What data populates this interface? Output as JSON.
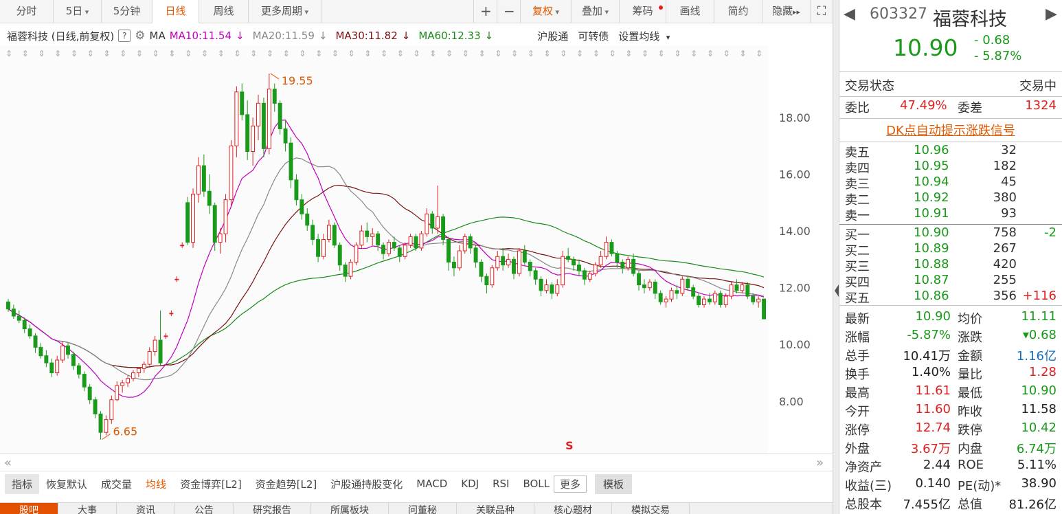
{
  "toolbar": {
    "tabs": [
      "分时",
      "5日",
      "5分钟",
      "日线",
      "周线",
      "更多周期"
    ],
    "right": [
      "+",
      "−",
      "复权",
      "叠加",
      "筹码",
      "画线",
      "简约",
      "隐藏"
    ],
    "hide_arrow": "▸▸",
    "fullscreen_icon": "⛶"
  },
  "info": {
    "name_mode": "福蓉科技 (日线,前复权)",
    "help": "?",
    "ma_label": "MA",
    "ma10": "MA10:11.54",
    "ma20": "MA20:11.59",
    "ma30": "MA30:11.82",
    "ma60": "MA60:12.33",
    "down_arrow": "↓",
    "links": [
      "沪股通",
      "可转债",
      "设置均线"
    ]
  },
  "colors": {
    "up": "#e02020",
    "down": "#1a9a1a",
    "ma10": "#c000c0",
    "ma20": "#888888",
    "ma30": "#7a1010",
    "ma60": "#1a8a1a",
    "accent": "#e05a00"
  },
  "chart_data": {
    "type": "candlestick",
    "ylim": [
      6.3,
      20.4
    ],
    "yticks": [
      "18.00",
      "16.00",
      "14.00",
      "12.00",
      "10.00",
      "8.00"
    ],
    "annotations": {
      "high": "19.55",
      "low": "6.65"
    },
    "marker": "S",
    "ohlc": [
      [
        11.5,
        11.6,
        11.15,
        11.25
      ],
      [
        11.25,
        11.4,
        10.9,
        11.0
      ],
      [
        11.0,
        11.2,
        10.75,
        10.85
      ],
      [
        10.85,
        10.95,
        10.4,
        10.55
      ],
      [
        10.55,
        10.7,
        10.2,
        10.3
      ],
      [
        10.3,
        10.4,
        9.7,
        9.9
      ],
      [
        9.9,
        10.05,
        9.5,
        9.6
      ],
      [
        9.6,
        9.8,
        9.2,
        9.35
      ],
      [
        9.35,
        9.5,
        8.85,
        9.0
      ],
      [
        9.0,
        9.6,
        8.9,
        9.45
      ],
      [
        9.45,
        10.1,
        9.35,
        9.95
      ],
      [
        9.95,
        10.05,
        9.5,
        9.65
      ],
      [
        9.65,
        9.75,
        9.1,
        9.25
      ],
      [
        9.25,
        9.35,
        8.8,
        8.95
      ],
      [
        8.95,
        9.05,
        8.35,
        8.5
      ],
      [
        8.5,
        8.6,
        7.9,
        8.05
      ],
      [
        8.05,
        8.15,
        7.4,
        7.55
      ],
      [
        7.55,
        7.65,
        6.65,
        6.9
      ],
      [
        6.9,
        7.5,
        6.8,
        7.35
      ],
      [
        7.35,
        8.2,
        7.2,
        8.05
      ],
      [
        8.05,
        8.7,
        8.0,
        8.55
      ],
      [
        8.55,
        8.75,
        8.3,
        8.65
      ],
      [
        8.65,
        8.9,
        8.5,
        8.8
      ],
      [
        8.8,
        9.1,
        8.7,
        9.0
      ],
      [
        9.0,
        9.2,
        8.85,
        9.15
      ],
      [
        9.15,
        9.4,
        9.0,
        9.3
      ],
      [
        9.3,
        9.9,
        9.25,
        9.75
      ],
      [
        9.75,
        10.3,
        9.6,
        10.15
      ],
      [
        10.15,
        11.2,
        9.25,
        9.35
      ],
      [
        10.3,
        10.4,
        10.2,
        10.3
      ],
      [
        11.1,
        11.2,
        11.0,
        11.1
      ],
      [
        12.3,
        12.4,
        12.2,
        12.3
      ],
      [
        13.5,
        13.6,
        13.4,
        13.5
      ],
      [
        15.0,
        15.2,
        13.5,
        13.6
      ],
      [
        13.6,
        15.5,
        13.4,
        15.3
      ],
      [
        15.3,
        16.6,
        15.0,
        16.3
      ],
      [
        16.3,
        16.7,
        15.2,
        15.4
      ],
      [
        15.4,
        16.0,
        14.6,
        14.9
      ],
      [
        14.9,
        15.0,
        13.3,
        13.6
      ],
      [
        13.6,
        14.1,
        13.2,
        13.9
      ],
      [
        13.9,
        15.3,
        13.6,
        15.1
      ],
      [
        15.1,
        17.2,
        14.9,
        17.0
      ],
      [
        17.0,
        19.1,
        16.6,
        18.9
      ],
      [
        18.9,
        19.2,
        17.9,
        18.1
      ],
      [
        18.1,
        18.6,
        16.5,
        16.8
      ],
      [
        16.8,
        18.0,
        16.3,
        17.7
      ],
      [
        17.7,
        18.8,
        17.2,
        18.5
      ],
      [
        18.5,
        18.7,
        16.6,
        16.9
      ],
      [
        16.9,
        19.55,
        16.7,
        19.0
      ],
      [
        19.0,
        19.2,
        18.2,
        18.5
      ],
      [
        18.5,
        18.6,
        17.4,
        17.6
      ],
      [
        17.6,
        17.9,
        16.8,
        17.1
      ],
      [
        17.1,
        17.3,
        15.5,
        15.8
      ],
      [
        15.8,
        16.0,
        14.9,
        15.1
      ],
      [
        15.1,
        15.3,
        14.4,
        14.6
      ],
      [
        14.6,
        14.8,
        14.0,
        14.2
      ],
      [
        14.2,
        14.4,
        13.5,
        13.7
      ],
      [
        13.7,
        13.9,
        12.9,
        13.1
      ],
      [
        13.1,
        13.9,
        13.0,
        13.7
      ],
      [
        13.7,
        14.4,
        13.6,
        14.2
      ],
      [
        14.2,
        14.3,
        13.4,
        13.5
      ],
      [
        13.5,
        13.6,
        12.6,
        12.8
      ],
      [
        12.8,
        12.9,
        12.2,
        12.4
      ],
      [
        12.4,
        13.0,
        12.3,
        12.9
      ],
      [
        12.9,
        13.6,
        12.8,
        13.5
      ],
      [
        13.5,
        14.2,
        13.4,
        14.0
      ],
      [
        14.0,
        14.3,
        13.6,
        13.8
      ],
      [
        13.8,
        14.1,
        13.5,
        13.9
      ],
      [
        13.9,
        14.0,
        13.3,
        13.5
      ],
      [
        13.5,
        13.6,
        13.0,
        13.2
      ],
      [
        13.2,
        13.7,
        13.1,
        13.6
      ],
      [
        13.6,
        13.8,
        13.3,
        13.4
      ],
      [
        13.4,
        13.5,
        12.9,
        13.1
      ],
      [
        13.1,
        13.6,
        13.0,
        13.5
      ],
      [
        13.5,
        13.9,
        13.4,
        13.8
      ],
      [
        13.8,
        13.9,
        13.3,
        13.4
      ],
      [
        13.4,
        14.0,
        13.3,
        13.9
      ],
      [
        13.9,
        14.8,
        13.8,
        14.6
      ],
      [
        14.6,
        14.7,
        13.9,
        14.1
      ],
      [
        14.1,
        15.6,
        13.9,
        14.5
      ],
      [
        14.5,
        14.6,
        13.5,
        13.7
      ],
      [
        13.7,
        13.8,
        12.6,
        12.9
      ],
      [
        12.9,
        13.1,
        12.4,
        12.7
      ],
      [
        12.7,
        13.5,
        12.6,
        13.3
      ],
      [
        13.3,
        13.9,
        13.2,
        13.8
      ],
      [
        13.8,
        13.9,
        13.2,
        13.4
      ],
      [
        13.4,
        13.5,
        12.7,
        12.9
      ],
      [
        12.9,
        13.0,
        12.2,
        12.4
      ],
      [
        12.4,
        12.5,
        11.8,
        12.1
      ],
      [
        12.1,
        12.8,
        12.0,
        12.7
      ],
      [
        12.7,
        13.3,
        12.6,
        13.1
      ],
      [
        13.1,
        13.4,
        12.6,
        12.8
      ],
      [
        12.8,
        13.2,
        12.7,
        13.0
      ],
      [
        13.0,
        13.1,
        12.3,
        12.5
      ],
      [
        12.5,
        13.4,
        12.4,
        13.3
      ],
      [
        13.3,
        13.5,
        12.8,
        12.9
      ],
      [
        12.9,
        13.0,
        12.4,
        12.6
      ],
      [
        12.6,
        12.7,
        12.1,
        12.3
      ],
      [
        12.3,
        12.4,
        11.7,
        11.9
      ],
      [
        11.9,
        12.3,
        11.8,
        12.1
      ],
      [
        12.1,
        12.2,
        11.6,
        11.8
      ],
      [
        11.8,
        12.3,
        11.7,
        12.1
      ],
      [
        12.1,
        13.3,
        12.0,
        13.1
      ],
      [
        13.1,
        13.4,
        12.9,
        13.0
      ],
      [
        13.0,
        13.1,
        12.6,
        12.8
      ],
      [
        12.8,
        13.0,
        12.4,
        12.6
      ],
      [
        12.6,
        12.7,
        12.1,
        12.3
      ],
      [
        12.3,
        12.6,
        12.2,
        12.5
      ],
      [
        12.5,
        12.9,
        12.4,
        12.8
      ],
      [
        12.8,
        13.3,
        12.7,
        13.1
      ],
      [
        13.1,
        13.8,
        13.0,
        13.6
      ],
      [
        13.6,
        13.7,
        13.1,
        13.2
      ],
      [
        13.2,
        13.3,
        12.7,
        12.9
      ],
      [
        12.9,
        13.0,
        12.5,
        12.7
      ],
      [
        12.7,
        13.1,
        12.6,
        13.0
      ],
      [
        13.0,
        13.2,
        12.4,
        12.5
      ],
      [
        12.5,
        12.6,
        11.9,
        12.1
      ],
      [
        12.1,
        12.3,
        11.8,
        12.0
      ],
      [
        12.0,
        12.3,
        11.9,
        12.2
      ],
      [
        12.2,
        12.3,
        11.6,
        11.8
      ],
      [
        11.8,
        11.9,
        11.4,
        11.5
      ],
      [
        11.5,
        11.7,
        11.3,
        11.6
      ],
      [
        11.6,
        12.0,
        11.5,
        11.9
      ],
      [
        11.9,
        12.1,
        11.6,
        11.8
      ],
      [
        11.8,
        12.4,
        11.7,
        12.3
      ],
      [
        12.3,
        12.4,
        11.9,
        12.0
      ],
      [
        12.0,
        12.1,
        11.6,
        11.7
      ],
      [
        11.7,
        11.8,
        11.3,
        11.4
      ],
      [
        11.4,
        11.7,
        11.3,
        11.6
      ],
      [
        11.6,
        11.8,
        11.4,
        11.5
      ],
      [
        11.5,
        11.9,
        11.4,
        11.8
      ],
      [
        11.8,
        11.9,
        11.3,
        11.4
      ],
      [
        11.4,
        11.8,
        11.3,
        11.7
      ],
      [
        11.7,
        12.2,
        11.6,
        12.1
      ],
      [
        12.1,
        12.3,
        11.8,
        11.9
      ],
      [
        11.9,
        12.2,
        11.8,
        12.1
      ],
      [
        12.1,
        12.2,
        11.6,
        11.7
      ],
      [
        11.7,
        11.8,
        11.4,
        11.5
      ],
      [
        11.5,
        11.7,
        11.3,
        11.6
      ],
      [
        11.6,
        11.61,
        10.9,
        10.9
      ]
    ]
  },
  "tabs": [
    "指标",
    "恢复默认",
    "成交量",
    "均线",
    "资金博弈[L2]",
    "资金趋势[L2]",
    "沪股通持股变化",
    "MACD",
    "KDJ",
    "RSI",
    "BOLL",
    "更多",
    "模板"
  ],
  "bottom_tabs": [
    "股吧",
    "大事",
    "资讯",
    "公告",
    "研究报告",
    "所属板块",
    "问董秘",
    "关联品种",
    "核心题材",
    "模拟交易"
  ],
  "quote": {
    "code": "603327",
    "name": "福蓉科技",
    "price": "10.90",
    "change": "- 0.68",
    "pct": "- 5.87%",
    "status_label": "交易状态",
    "status": "交易中",
    "weibi_label": "委比",
    "weibi": "47.49%",
    "weicha_label": "委差",
    "weicha": "1324",
    "signal": "DK点自动提示涨跌信号",
    "asks": [
      {
        "label": "卖五",
        "price": "10.96",
        "vol": "32",
        "chg": ""
      },
      {
        "label": "卖四",
        "price": "10.95",
        "vol": "182",
        "chg": ""
      },
      {
        "label": "卖三",
        "price": "10.94",
        "vol": "45",
        "chg": ""
      },
      {
        "label": "卖二",
        "price": "10.92",
        "vol": "380",
        "chg": ""
      },
      {
        "label": "卖一",
        "price": "10.91",
        "vol": "93",
        "chg": ""
      }
    ],
    "bids": [
      {
        "label": "买一",
        "price": "10.90",
        "vol": "758",
        "chg": "-2"
      },
      {
        "label": "买二",
        "price": "10.89",
        "vol": "267",
        "chg": ""
      },
      {
        "label": "买三",
        "price": "10.88",
        "vol": "420",
        "chg": ""
      },
      {
        "label": "买四",
        "price": "10.87",
        "vol": "255",
        "chg": ""
      },
      {
        "label": "买五",
        "price": "10.86",
        "vol": "356",
        "chg": "+116"
      }
    ],
    "stats": [
      {
        "l1": "最新",
        "v1": "10.90",
        "c1": "green",
        "l2": "均价",
        "v2": "11.11",
        "c2": "green"
      },
      {
        "l1": "涨幅",
        "v1": "-5.87%",
        "c1": "green",
        "l2": "涨跌",
        "v2": "▾0.68",
        "c2": "green"
      },
      {
        "l1": "总手",
        "v1": "10.41万",
        "c1": "black",
        "l2": "金额",
        "v2": "1.16亿",
        "c2": "blue"
      },
      {
        "l1": "换手",
        "v1": "1.40%",
        "c1": "black",
        "l2": "量比",
        "v2": "1.28",
        "c2": "red"
      },
      {
        "l1": "最高",
        "v1": "11.61",
        "c1": "red",
        "l2": "最低",
        "v2": "10.90",
        "c2": "green"
      },
      {
        "l1": "今开",
        "v1": "11.60",
        "c1": "red",
        "l2": "昨收",
        "v2": "11.58",
        "c2": "black"
      },
      {
        "l1": "涨停",
        "v1": "12.74",
        "c1": "red",
        "l2": "跌停",
        "v2": "10.42",
        "c2": "green"
      },
      {
        "l1": "外盘",
        "v1": "3.67万",
        "c1": "red",
        "l2": "内盘",
        "v2": "6.74万",
        "c2": "green"
      },
      {
        "l1": "净资产",
        "v1": "2.44",
        "c1": "black",
        "l2": "ROE",
        "v2": "5.11%",
        "c2": "black"
      },
      {
        "l1": "收益(三)",
        "v1": "0.140",
        "c1": "black",
        "l2": "PE(动)*",
        "v2": "38.90",
        "c2": "black"
      },
      {
        "l1": "总股本",
        "v1": "7.455亿",
        "c1": "black",
        "l2": "总值",
        "v2": "81.26亿",
        "c2": "black"
      }
    ]
  }
}
